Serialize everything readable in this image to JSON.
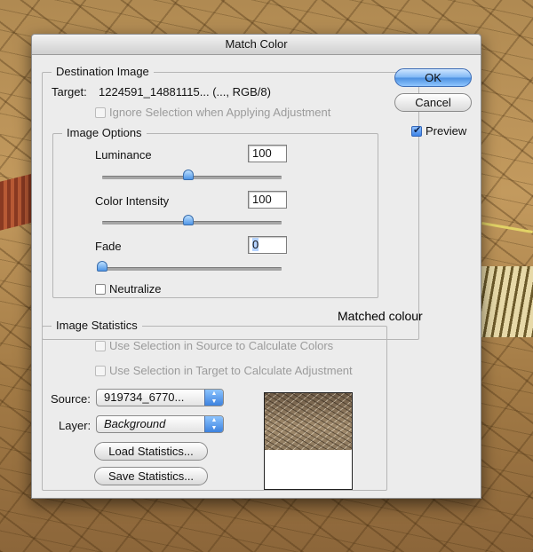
{
  "dialog": {
    "title": "Match Color",
    "destination": {
      "legend": "Destination Image",
      "target_label": "Target:",
      "target_value": "1224591_14881115... (..., RGB/8)",
      "ignore_selection": "Ignore Selection when Applying Adjustment"
    },
    "image_options": {
      "legend": "Image Options",
      "luminance_label": "Luminance",
      "luminance_value": "100",
      "luminance_level": 100,
      "color_intensity_label": "Color Intensity",
      "color_intensity_value": "100",
      "color_intensity_level": 100,
      "fade_label": "Fade",
      "fade_value": "0",
      "fade_level": 0,
      "neutralize_label": "Neutralize"
    },
    "image_statistics": {
      "legend": "Image Statistics",
      "use_source": "Use Selection in Source to Calculate Colors",
      "use_target": "Use Selection in Target to Calculate Adjustment",
      "source_label": "Source:",
      "source_value": "919734_6770...",
      "layer_label": "Layer:",
      "layer_value": "Background",
      "load_button": "Load Statistics...",
      "save_button": "Save Statistics..."
    },
    "buttons": {
      "ok": "OK",
      "cancel": "Cancel",
      "preview": "Preview"
    }
  },
  "annotation": "Matched colour",
  "colors": {
    "accent": "#4b8fe0",
    "dialog_bg": "#ececec"
  }
}
